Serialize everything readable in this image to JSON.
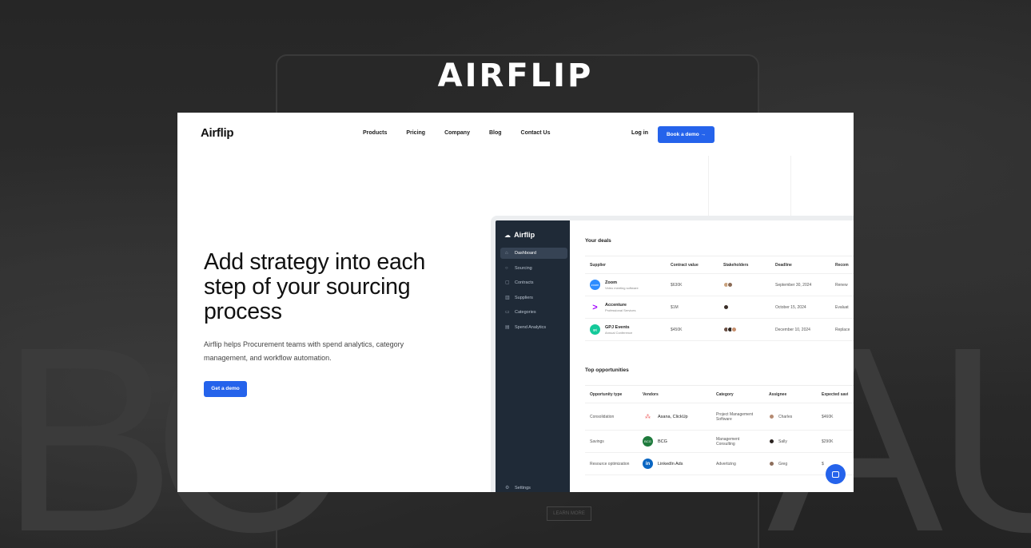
{
  "banner": {
    "title": "AIRFLIP"
  },
  "nav": {
    "logo": "Airflip",
    "links": [
      "Products",
      "Pricing",
      "Company",
      "Blog",
      "Contact Us"
    ],
    "login": "Log in",
    "cta": "Book a demo →"
  },
  "hero": {
    "headline": "Add strategy into each step of your sourcing process",
    "subtitle": "Airflip helps Procurement teams with spend analytics, category management, and workflow automation.",
    "cta": "Get a demo"
  },
  "app": {
    "logo": "Airflip",
    "sidebar": [
      {
        "label": "Dashboard",
        "icon": "home-icon",
        "active": true
      },
      {
        "label": "Sourcing",
        "icon": "search-icon",
        "active": false
      },
      {
        "label": "Contracts",
        "icon": "document-icon",
        "active": false
      },
      {
        "label": "Suppliers",
        "icon": "building-icon",
        "active": false
      },
      {
        "label": "Categories",
        "icon": "folder-icon",
        "active": false
      },
      {
        "label": "Spend Analytics",
        "icon": "chart-icon",
        "active": false
      }
    ],
    "settings": "Settings",
    "deals": {
      "title": "Your deals",
      "headers": [
        "Supplier",
        "Contract value",
        "Stakeholders",
        "Deadline",
        "Recom"
      ],
      "rows": [
        {
          "name": "Zoom",
          "desc": "Video meeting software",
          "value": "$630K",
          "deadline": "September 30, 2024",
          "rec": "Renew",
          "color": "#2d8cff",
          "badge": "zoom"
        },
        {
          "name": "Accenture",
          "desc": "Professional Services",
          "value": "$1M",
          "deadline": "October 15, 2024",
          "rec": "Evaluat",
          "color": "#a100ff",
          "badge": ">"
        },
        {
          "name": "GPJ Events",
          "desc": "Annual Conference",
          "value": "$450K",
          "deadline": "December 10, 2024",
          "rec": "Replace",
          "color": "#14c99a",
          "badge": "gpj"
        }
      ]
    },
    "opportunities": {
      "title": "Top opportunities",
      "headers": [
        "Opportunity type",
        "Vendors",
        "Category",
        "Assignee",
        "Expected savi"
      ],
      "rows": [
        {
          "type": "Consolidation",
          "vendors": "Asana, ClickUp",
          "category": "Project Management Software",
          "assignee": "Charles",
          "savings": "$460K"
        },
        {
          "type": "Savings",
          "vendors": "BCG",
          "category": "Management Consulting",
          "assignee": "Sally",
          "savings": "$290K"
        },
        {
          "type": "Resource optimization",
          "vendors": "LinkedIn Ads",
          "category": "Advertizing",
          "assignee": "Greg",
          "savings": "$"
        }
      ]
    }
  },
  "background": {
    "button": "LEARN MORE"
  }
}
